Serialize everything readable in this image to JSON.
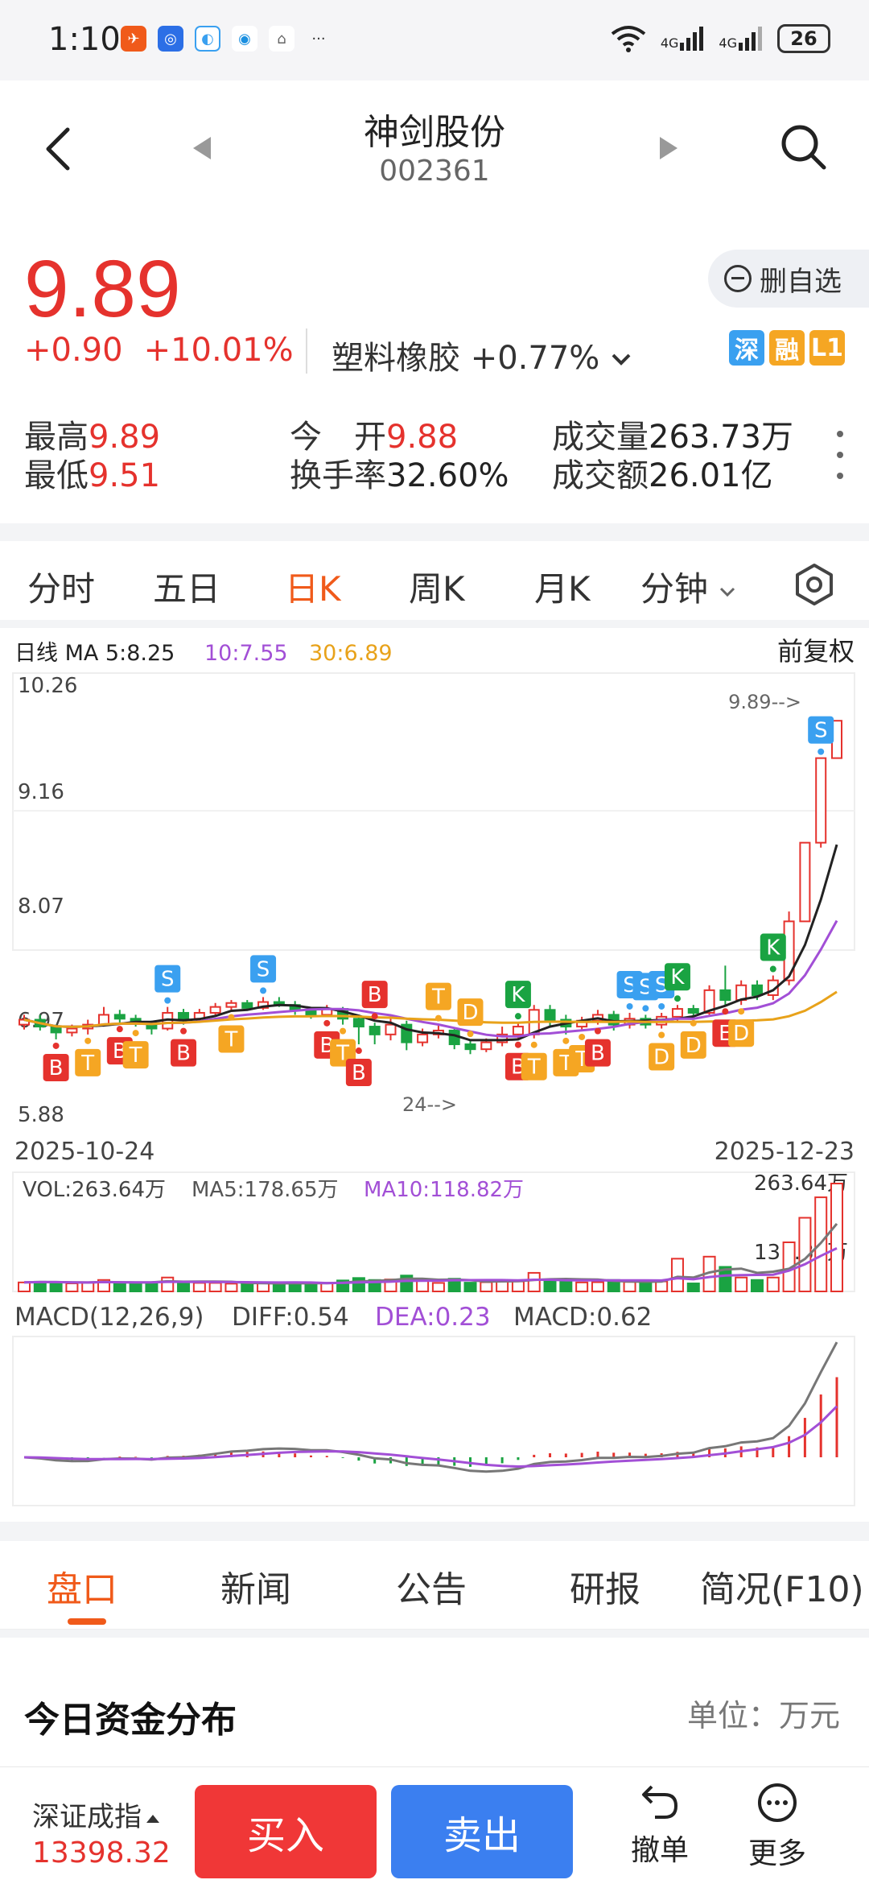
{
  "status_bar": {
    "time": "1:10",
    "battery": "26",
    "network_1": "4G",
    "network_2": "4G"
  },
  "header": {
    "stock_name": "神剑股份",
    "stock_code": "002361"
  },
  "quote": {
    "price": "9.89",
    "change": "+0.90",
    "change_pct": "+10.01%",
    "sector": "塑料橡胶 +0.77%",
    "remove_fav_label": "删自选",
    "tags": [
      "深",
      "融",
      "L1"
    ],
    "stats": {
      "high_label": "最高",
      "high": "9.89",
      "low_label": "最低",
      "low": "9.51",
      "open_label": "今　开",
      "open": "9.88",
      "turnover_label": "换手率",
      "turnover": "32.60%",
      "volume_label": "成交量",
      "volume": "263.73万",
      "amount_label": "成交额",
      "amount": "26.01亿"
    }
  },
  "period_tabs": [
    "分时",
    "五日",
    "日K",
    "周K",
    "月K",
    "分钟"
  ],
  "active_period": "日K",
  "chart": {
    "ma_prefix": "日线 MA 5:8.25",
    "ma10": "10:7.55",
    "ma30": "30:6.89",
    "adjust_label": "前复权",
    "price_ticks": [
      "10.26",
      "9.16",
      "8.07",
      "6.97",
      "5.88"
    ],
    "date_start": "2025-10-24",
    "date_end": "2025-12-23",
    "high_note": "9.89-->",
    "low_note": "24-->",
    "vol_label": "VOL:263.64万",
    "vol_ma5": "MA5:178.65万",
    "vol_ma10": "MA10:118.82万",
    "vol_max": "263.64万",
    "vol_mid": "131.82万",
    "macd_label": "MACD(12,26,9)",
    "macd_diff": "DIFF:0.54",
    "macd_dea": "DEA:0.23",
    "macd_val": "MACD:0.62"
  },
  "bottom_tabs": [
    "盘口",
    "新闻",
    "公告",
    "研报",
    "简况(F10)"
  ],
  "fund": {
    "title": "今日资金分布",
    "unit": "单位：万元"
  },
  "bottom_bar": {
    "index_name": "深证成指",
    "index_value": "13398.32",
    "buy": "买入",
    "sell": "卖出",
    "cancel": "撤单",
    "more": "更多"
  },
  "colors": {
    "up": "#e5322d",
    "down": "#1aa342",
    "accent": "#f05a1a",
    "ma5": "#222222",
    "ma10": "#a24fd6",
    "ma30": "#e8a21a"
  },
  "chart_data": {
    "type": "candlestick",
    "title": "",
    "price_range": [
      5.88,
      10.26
    ],
    "x_range": [
      "2025-10-24",
      "2025-12-23"
    ],
    "candles_approx": [
      {
        "o": 6.8,
        "c": 6.85,
        "h": 6.9,
        "l": 6.75
      },
      {
        "o": 6.85,
        "c": 6.78,
        "h": 6.9,
        "l": 6.74
      },
      {
        "o": 6.78,
        "c": 6.72,
        "h": 6.8,
        "l": 6.65
      },
      {
        "o": 6.72,
        "c": 6.76,
        "h": 6.8,
        "l": 6.68
      },
      {
        "o": 6.76,
        "c": 6.8,
        "h": 6.85,
        "l": 6.7
      },
      {
        "o": 6.8,
        "c": 6.9,
        "h": 6.98,
        "l": 6.78
      },
      {
        "o": 6.9,
        "c": 6.86,
        "h": 6.95,
        "l": 6.82
      },
      {
        "o": 6.86,
        "c": 6.82,
        "h": 6.9,
        "l": 6.78
      },
      {
        "o": 6.82,
        "c": 6.76,
        "h": 6.84,
        "l": 6.7
      },
      {
        "o": 6.76,
        "c": 6.92,
        "h": 6.98,
        "l": 6.74
      },
      {
        "o": 6.92,
        "c": 6.86,
        "h": 6.96,
        "l": 6.8
      },
      {
        "o": 6.86,
        "c": 6.92,
        "h": 6.96,
        "l": 6.84
      },
      {
        "o": 6.92,
        "c": 6.98,
        "h": 7.02,
        "l": 6.9
      },
      {
        "o": 6.98,
        "c": 7.02,
        "h": 7.05,
        "l": 6.94
      },
      {
        "o": 7.02,
        "c": 6.97,
        "h": 7.05,
        "l": 6.94
      },
      {
        "o": 6.97,
        "c": 7.03,
        "h": 7.08,
        "l": 6.95
      },
      {
        "o": 7.03,
        "c": 7.0,
        "h": 7.08,
        "l": 6.98
      },
      {
        "o": 7.0,
        "c": 6.95,
        "h": 7.04,
        "l": 6.9
      },
      {
        "o": 6.95,
        "c": 6.9,
        "h": 6.98,
        "l": 6.86
      },
      {
        "o": 6.9,
        "c": 6.96,
        "h": 7.0,
        "l": 6.88
      },
      {
        "o": 6.96,
        "c": 6.86,
        "h": 6.98,
        "l": 6.8
      },
      {
        "o": 6.86,
        "c": 6.78,
        "h": 6.9,
        "l": 6.6
      },
      {
        "o": 6.78,
        "c": 6.7,
        "h": 6.82,
        "l": 6.6
      },
      {
        "o": 6.7,
        "c": 6.8,
        "h": 6.86,
        "l": 6.64
      },
      {
        "o": 6.8,
        "c": 6.62,
        "h": 6.84,
        "l": 6.54
      },
      {
        "o": 6.62,
        "c": 6.7,
        "h": 6.76,
        "l": 6.58
      },
      {
        "o": 6.7,
        "c": 6.74,
        "h": 6.8,
        "l": 6.66
      },
      {
        "o": 6.74,
        "c": 6.6,
        "h": 6.76,
        "l": 6.55
      },
      {
        "o": 6.6,
        "c": 6.55,
        "h": 6.64,
        "l": 6.5
      },
      {
        "o": 6.55,
        "c": 6.62,
        "h": 6.66,
        "l": 6.52
      },
      {
        "o": 6.62,
        "c": 6.7,
        "h": 6.78,
        "l": 6.58
      },
      {
        "o": 6.7,
        "c": 6.78,
        "h": 6.82,
        "l": 6.66
      },
      {
        "o": 6.7,
        "c": 6.95,
        "h": 7.0,
        "l": 6.66
      },
      {
        "o": 6.95,
        "c": 6.85,
        "h": 7.0,
        "l": 6.78
      },
      {
        "o": 6.85,
        "c": 6.78,
        "h": 6.9,
        "l": 6.7
      },
      {
        "o": 6.78,
        "c": 6.84,
        "h": 6.88,
        "l": 6.74
      },
      {
        "o": 6.84,
        "c": 6.9,
        "h": 6.95,
        "l": 6.8
      },
      {
        "o": 6.9,
        "c": 6.8,
        "h": 6.94,
        "l": 6.74
      },
      {
        "o": 6.8,
        "c": 6.86,
        "h": 6.92,
        "l": 6.76
      },
      {
        "o": 6.86,
        "c": 6.8,
        "h": 6.9,
        "l": 6.76
      },
      {
        "o": 6.8,
        "c": 6.88,
        "h": 6.92,
        "l": 6.76
      },
      {
        "o": 6.88,
        "c": 6.96,
        "h": 7.0,
        "l": 6.84
      },
      {
        "o": 6.96,
        "c": 6.92,
        "h": 7.0,
        "l": 6.88
      },
      {
        "o": 6.92,
        "c": 7.15,
        "h": 7.2,
        "l": 6.9
      },
      {
        "o": 7.15,
        "c": 7.05,
        "h": 7.4,
        "l": 7.0
      },
      {
        "o": 7.05,
        "c": 7.2,
        "h": 7.25,
        "l": 7.0
      },
      {
        "o": 7.2,
        "c": 7.1,
        "h": 7.25,
        "l": 7.05
      },
      {
        "o": 7.1,
        "c": 7.25,
        "h": 7.3,
        "l": 7.05
      },
      {
        "o": 7.25,
        "c": 7.85,
        "h": 7.95,
        "l": 7.2
      },
      {
        "o": 7.85,
        "c": 8.65,
        "h": 8.65,
        "l": 7.85
      },
      {
        "o": 8.65,
        "c": 9.51,
        "h": 9.51,
        "l": 8.6
      },
      {
        "o": 9.51,
        "c": 9.89,
        "h": 9.89,
        "l": 9.51
      }
    ],
    "volume_range": [
      0,
      263.64
    ],
    "volume_last": 263.64
  }
}
